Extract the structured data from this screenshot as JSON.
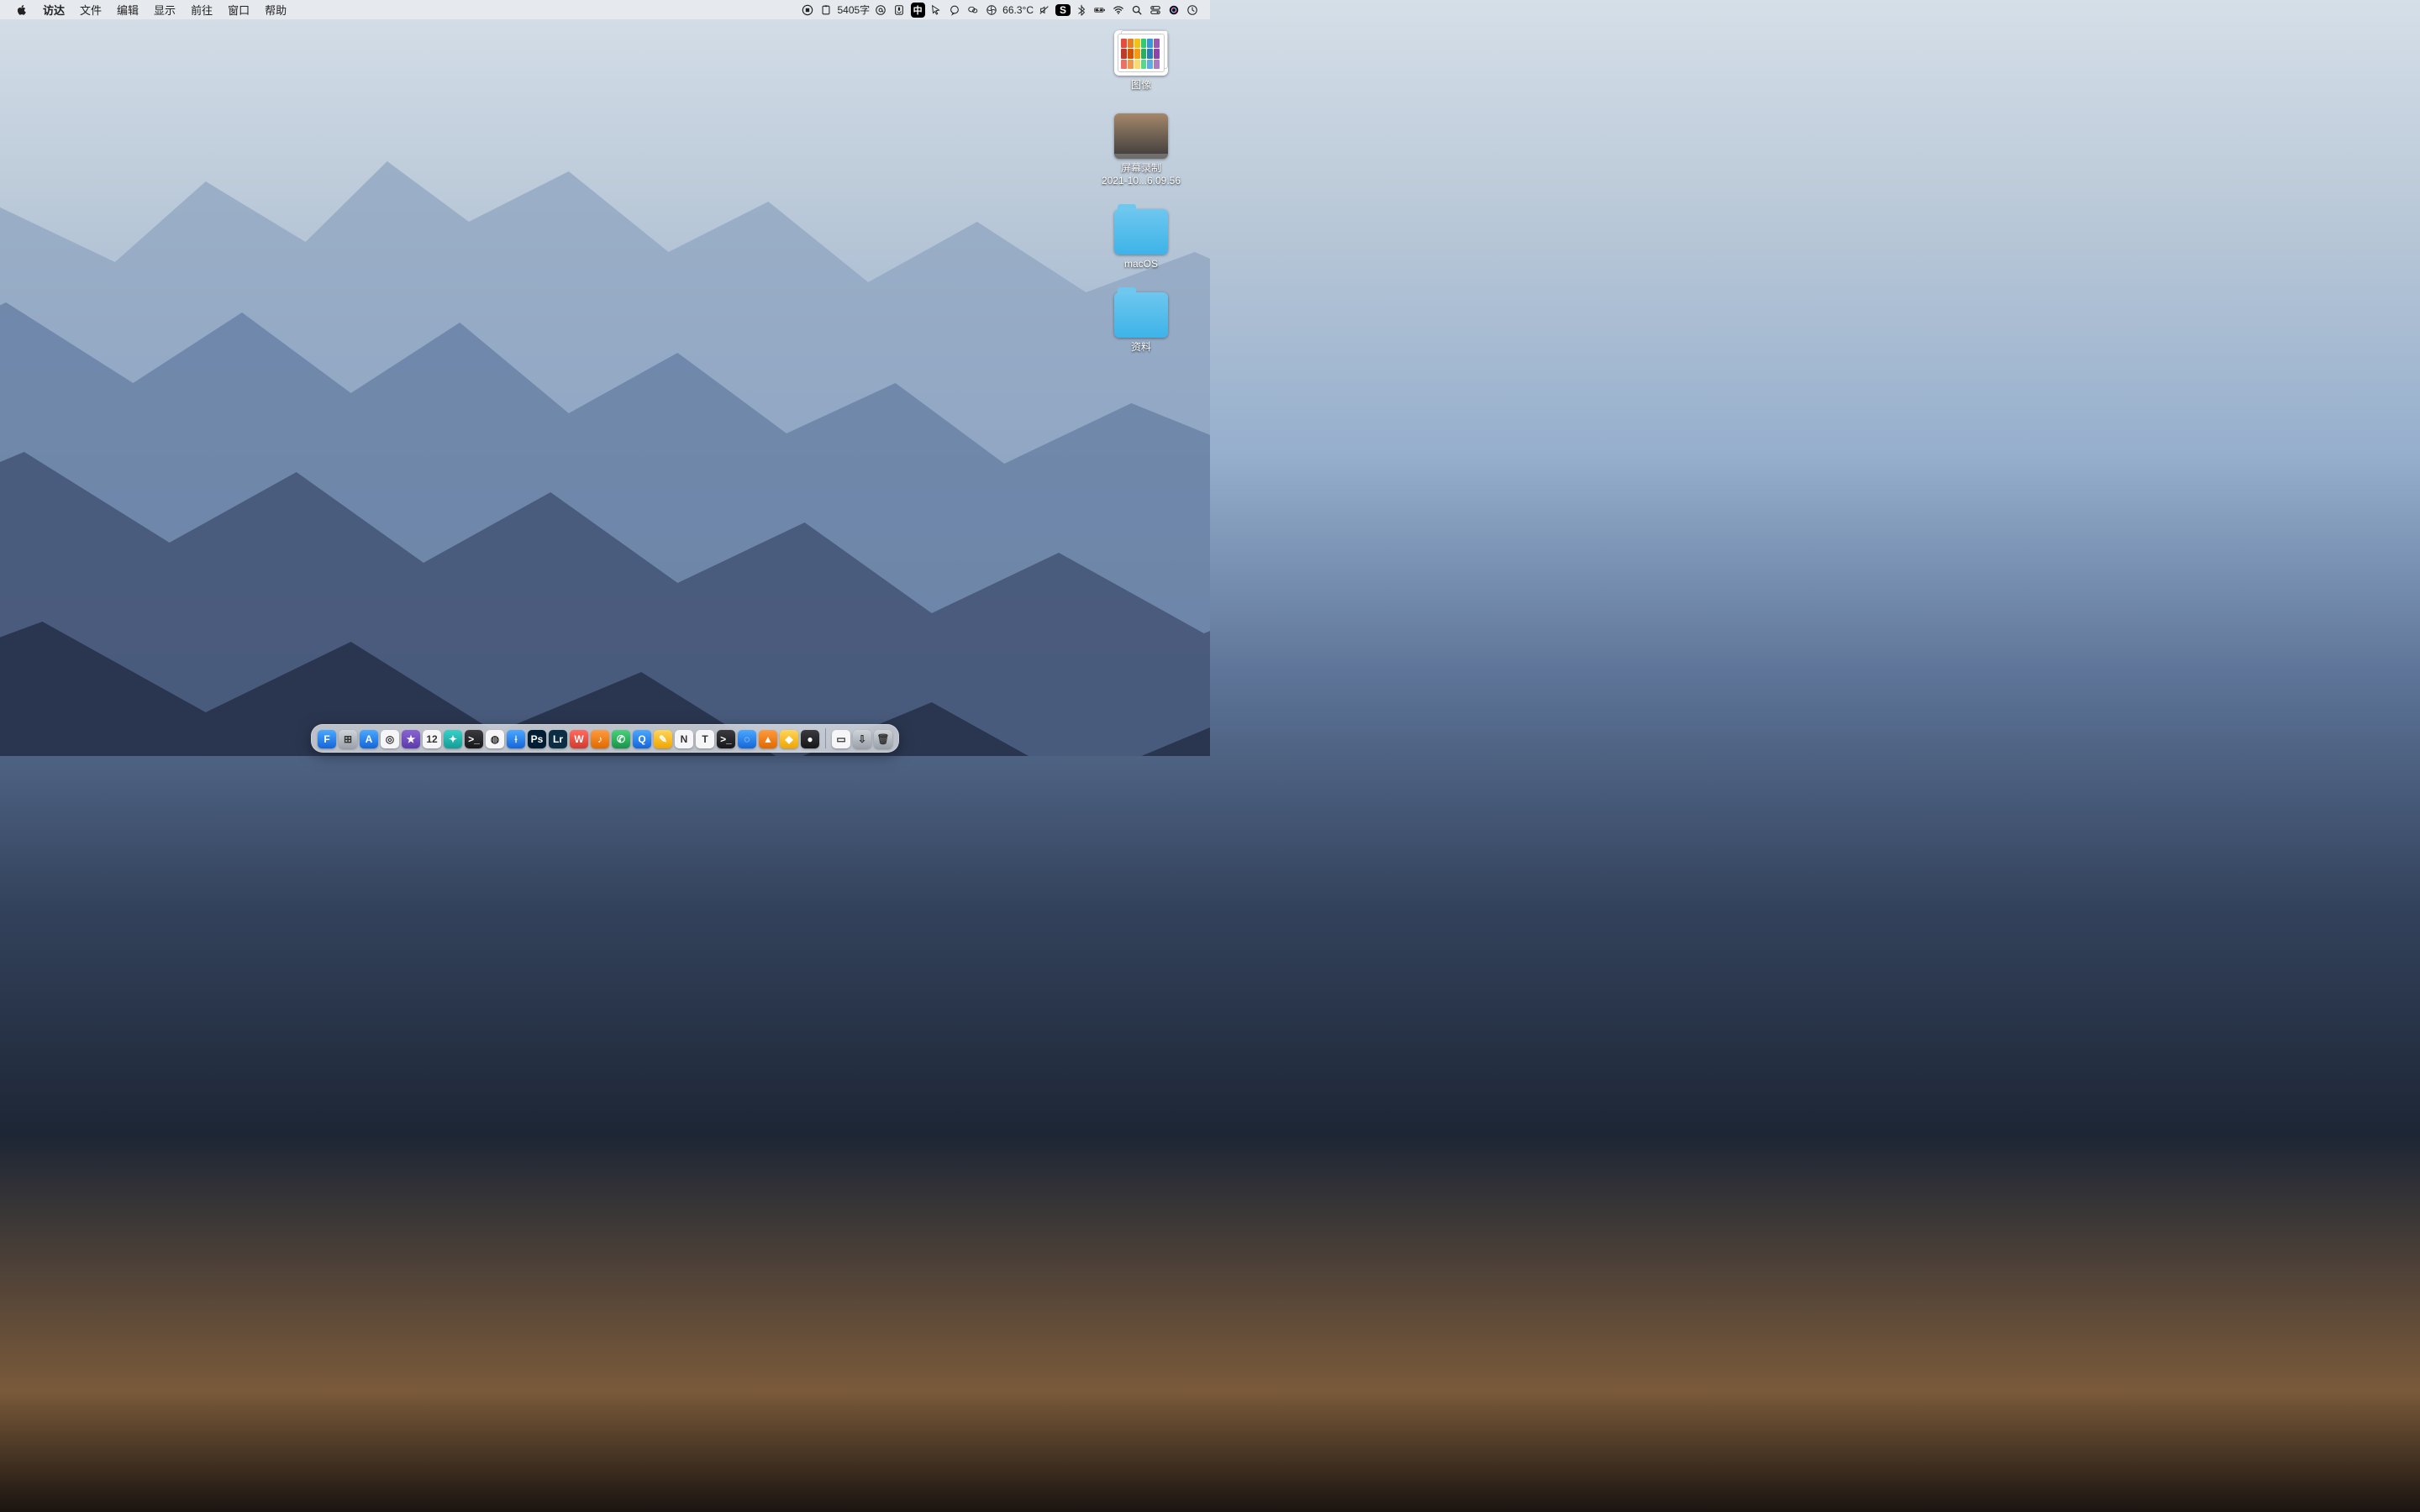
{
  "menubar": {
    "app": "访达",
    "items": [
      "文件",
      "编辑",
      "显示",
      "前往",
      "窗口",
      "帮助"
    ],
    "status": {
      "char_count": "5405字",
      "ime_lang": "中",
      "temperature": "66.3°C"
    }
  },
  "desktop": {
    "icons": [
      {
        "name": "图像",
        "kind": "image-stack"
      },
      {
        "name": "屏幕录制\n2021-10...6.09.56",
        "kind": "video"
      },
      {
        "name": "macOS",
        "kind": "folder"
      },
      {
        "name": "资料",
        "kind": "folder"
      }
    ]
  },
  "dock": {
    "items": [
      {
        "name": "finder",
        "label": "F",
        "cls": "c-blue"
      },
      {
        "name": "launchpad",
        "label": "⊞",
        "cls": "c-grey"
      },
      {
        "name": "app-store",
        "label": "A",
        "cls": "c-blue"
      },
      {
        "name": "safari",
        "label": "◎",
        "cls": "c-white"
      },
      {
        "name": "imovie",
        "label": "★",
        "cls": "c-purple"
      },
      {
        "name": "calendar",
        "label": "12",
        "cls": "c-white"
      },
      {
        "name": "feishu",
        "label": "✦",
        "cls": "c-teal"
      },
      {
        "name": "iterm",
        "label": ">_",
        "cls": "c-dark"
      },
      {
        "name": "chrome",
        "label": "◍",
        "cls": "c-white"
      },
      {
        "name": "vscode",
        "label": "⟊",
        "cls": "c-blue"
      },
      {
        "name": "photoshop",
        "label": "Ps",
        "cls": "c-ps"
      },
      {
        "name": "lightroom",
        "label": "Lr",
        "cls": "c-lrblue"
      },
      {
        "name": "wps",
        "label": "W",
        "cls": "c-red"
      },
      {
        "name": "music",
        "label": "♪",
        "cls": "c-orange"
      },
      {
        "name": "wechat",
        "label": "✆",
        "cls": "c-green"
      },
      {
        "name": "qq",
        "label": "Q",
        "cls": "c-blue"
      },
      {
        "name": "notes",
        "label": "✎",
        "cls": "c-yellow"
      },
      {
        "name": "notion",
        "label": "N",
        "cls": "c-white"
      },
      {
        "name": "typora",
        "label": "T",
        "cls": "c-white"
      },
      {
        "name": "terminal2",
        "label": ">_",
        "cls": "c-dark"
      },
      {
        "name": "dingtalk",
        "label": "◌",
        "cls": "c-blue"
      },
      {
        "name": "vlc",
        "label": "▲",
        "cls": "c-orange"
      },
      {
        "name": "sketch",
        "label": "◆",
        "cls": "c-yellow"
      },
      {
        "name": "siri",
        "label": "●",
        "cls": "c-dark"
      }
    ],
    "right": [
      {
        "name": "recent-doc",
        "label": "▭",
        "cls": "c-white"
      },
      {
        "name": "downloads",
        "label": "⇩",
        "cls": "c-grey"
      },
      {
        "name": "trash",
        "label": "🗑",
        "cls": "c-grey"
      }
    ]
  }
}
